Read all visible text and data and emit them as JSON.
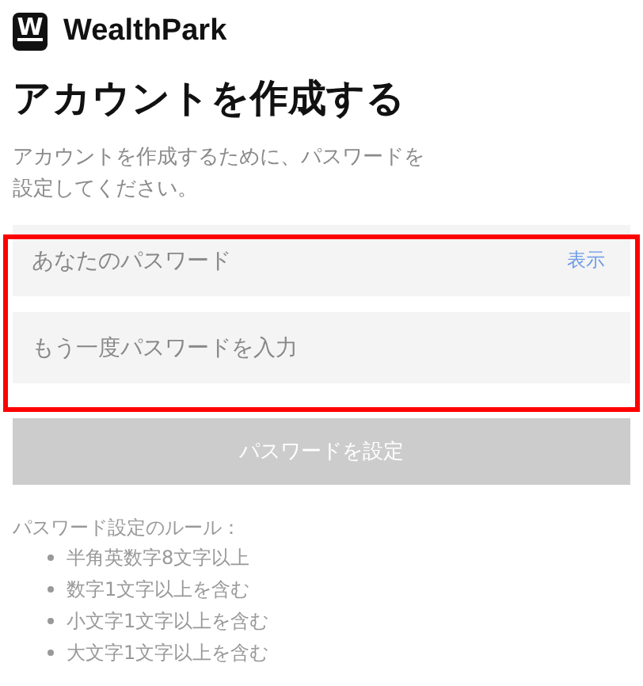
{
  "logo": {
    "mark": "W",
    "name": "WealthPark"
  },
  "title": "アカウントを作成する",
  "description": "アカウントを作成するために、パスワードを設定してください。",
  "form": {
    "highlighted": true,
    "fields": [
      {
        "placeholder": "あなたのパスワード",
        "toggle": "表示"
      },
      {
        "placeholder": "もう一度パスワードを入力"
      }
    ],
    "submit": {
      "label": "パスワードを設定",
      "disabled": true
    }
  },
  "rules": {
    "heading": "パスワード設定のルール：",
    "items": [
      "半角英数字8文字以上",
      "数字1文字以上を含む",
      "小文字1文字以上を含む",
      "大文字1文字以上を含む"
    ]
  }
}
